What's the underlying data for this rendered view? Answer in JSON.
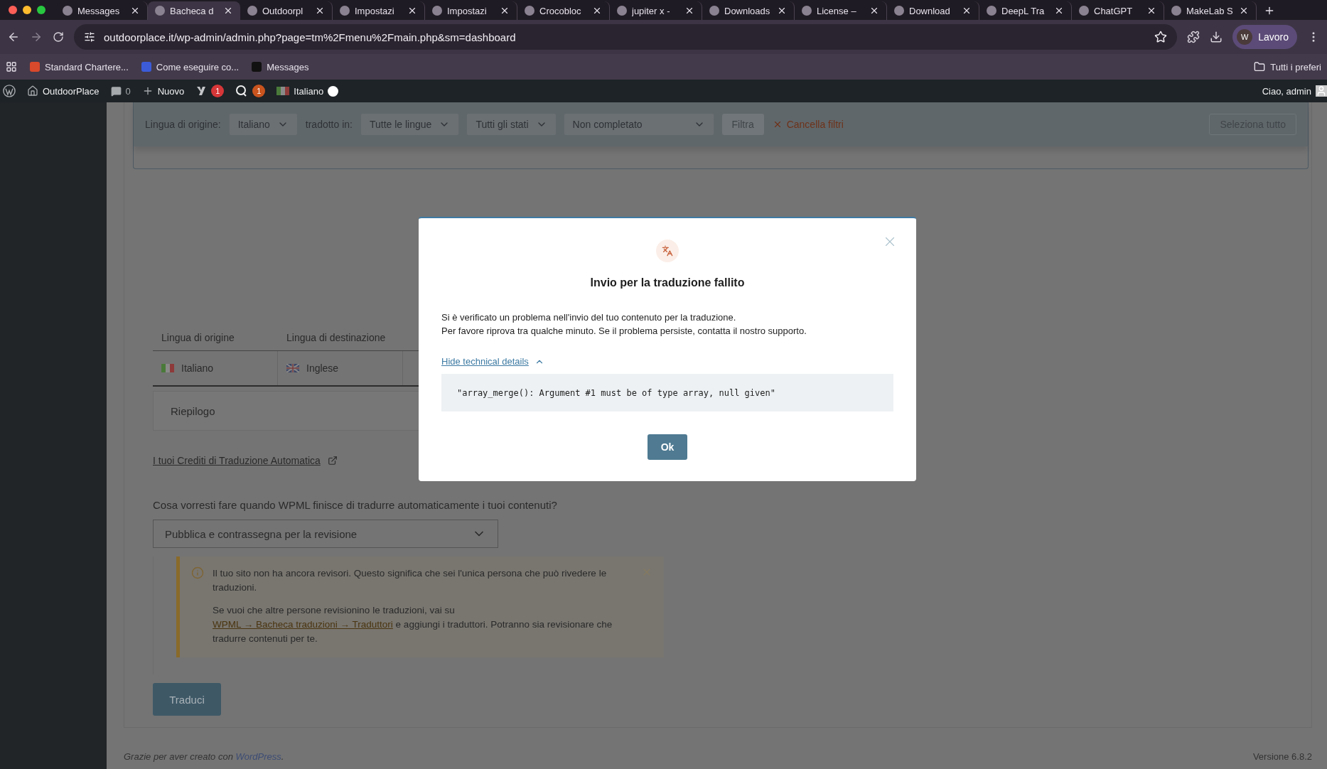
{
  "browser": {
    "tabs": [
      {
        "title": "Messages",
        "selected": false
      },
      {
        "title": "Bacheca d",
        "selected": true
      },
      {
        "title": "Outdoorpl",
        "selected": false
      },
      {
        "title": "Impostazi",
        "selected": false
      },
      {
        "title": "Impostazi",
        "selected": false
      },
      {
        "title": "Crocobloc",
        "selected": false
      },
      {
        "title": "jupiter x -",
        "selected": false
      },
      {
        "title": "Downloads",
        "selected": false
      },
      {
        "title": "License –",
        "selected": false
      },
      {
        "title": "Download",
        "selected": false
      },
      {
        "title": "DeepL Tra",
        "selected": false
      },
      {
        "title": "ChatGPT",
        "selected": false
      },
      {
        "title": "MakeLab S",
        "selected": false
      }
    ],
    "url": "outdoorplace.it/wp-admin/admin.php?page=tm%2Fmenu%2Fmain.php&sm=dashboard",
    "profile_initial": "W",
    "profile": "Lavoro",
    "bookmarks": [
      "Standard Chartere...",
      "Come eseguire co...",
      "Messages"
    ],
    "bookmarks_folder": "Tutti i preferi"
  },
  "admin_bar": {
    "site": "OutdoorPlace",
    "comments": "0",
    "new": "Nuovo",
    "seo_count": "1",
    "updates_count": "1",
    "language": "Italiano",
    "greeting": "Ciao, admin"
  },
  "filters": {
    "origin_label": "Lingua di origine:",
    "origin": "Italiano",
    "target_label": "tradotto in:",
    "target": "Tutte le lingue",
    "status": "Tutti gli stati",
    "completion": "Non completato",
    "filter_button": {
      "label": "Filtra",
      "disabled": true
    },
    "clear": "Cancella filtri",
    "select_all": {
      "label": "Seleziona tutto",
      "disabled": true
    }
  },
  "table": {
    "columns": [
      "Lingua di origine",
      "Lingua di destinazione"
    ],
    "rows": [
      [
        "Italiano",
        "Inglese"
      ]
    ],
    "summary": "Riepilogo"
  },
  "credits_link": "I tuoi Crediti di Traduzione Automatica",
  "question": "Cosa vorresti fare quando WPML finisce di tradurre automaticamente i tuoi contenuti?",
  "publish_select": "Pubblica e contrassegna per la revisione",
  "notice": {
    "text": "Il tuo sito non ha ancora revisori. Questo significa che sei l'unica persona che può rivedere le traduzioni.",
    "before": "Se vuoi che altre persone revisionino le traduzioni, vai su ",
    "link": "WPML → Bacheca traduzioni → Traduttori",
    "after": " e aggiungi i traduttori. Potranno sia revisionare che tradurre contenuti per te."
  },
  "translate_button": "Traduci",
  "footer": {
    "before": "Grazie per aver creato con ",
    "link": "WordPress",
    "after": ".",
    "version": "Versione 6.8.2"
  },
  "modal": {
    "title": "Invio per la traduzione fallito",
    "lines": [
      "Si è verificato un problema nell'invio del tuo contenuto per la traduzione.",
      "Per favore riprova tra qualche minuto. Se il problema persiste, contatta il nostro supporto."
    ],
    "details_toggle": "Hide technical details",
    "details_expanded": true,
    "error": "\"array_merge(): Argument #1 must be of type array, null given\"",
    "ok": "Ok"
  }
}
